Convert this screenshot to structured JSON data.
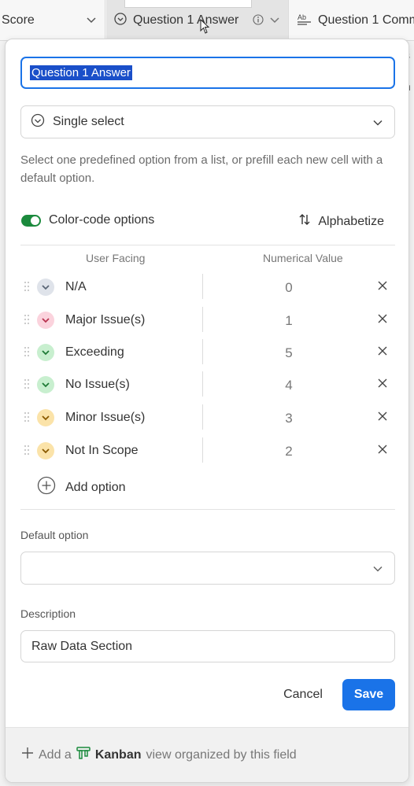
{
  "columns": {
    "score": {
      "label": "Score"
    },
    "q1_answer": {
      "label": "Question 1 Answer"
    },
    "q1_comment": {
      "label": "Question 1 Comm"
    }
  },
  "field_editor": {
    "name_value": "Question 1 Answer",
    "type_label": "Single select",
    "description": "Select one predefined option from a list, or prefill each new cell with a default option.",
    "color_code_label": "Color-code options",
    "color_code_enabled": true,
    "alphabetize_label": "Alphabetize",
    "column_headers": {
      "user_facing": "User Facing",
      "numerical_value": "Numerical Value"
    },
    "options": [
      {
        "label": "N/A",
        "value": "0",
        "color": "#dfe3ea",
        "chevron": "#5a6676"
      },
      {
        "label": "Major Issue(s)",
        "value": "1",
        "color": "#fbd3dd",
        "chevron": "#b8334f"
      },
      {
        "label": "Exceeding",
        "value": "5",
        "color": "#c8efcf",
        "chevron": "#1f7a36"
      },
      {
        "label": "No Issue(s)",
        "value": "4",
        "color": "#c8efcf",
        "chevron": "#1f7a36"
      },
      {
        "label": "Minor Issue(s)",
        "value": "3",
        "color": "#fbe3a9",
        "chevron": "#8a5a00"
      },
      {
        "label": "Not In Scope",
        "value": "2",
        "color": "#fbe3a9",
        "chevron": "#8a5a00"
      }
    ],
    "add_option_label": "Add option",
    "default_option_label": "Default option",
    "default_option_value": "",
    "description_label": "Description",
    "description_value": "Raw Data Section",
    "cancel_label": "Cancel",
    "save_label": "Save"
  },
  "footer": {
    "prefix": "Add a",
    "view_name": "Kanban",
    "suffix": "view organized by this field"
  },
  "colors": {
    "accent": "#1a73e8",
    "toggle_on": "#1b8a3d"
  }
}
